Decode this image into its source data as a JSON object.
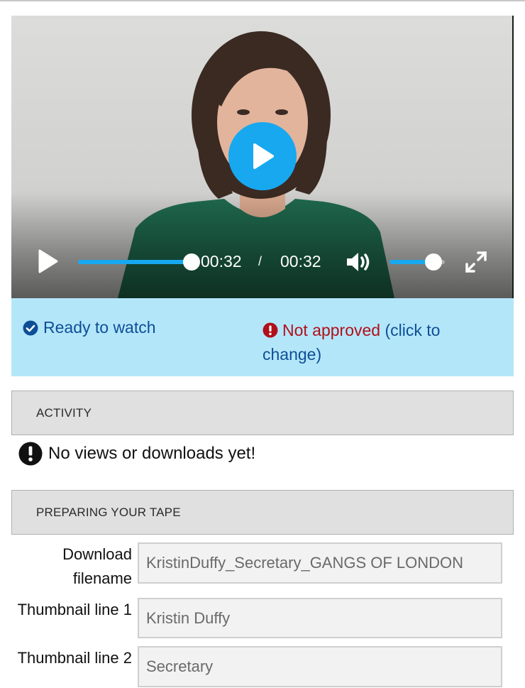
{
  "player": {
    "current_time": "00:32",
    "separator": "/",
    "duration": "00:32",
    "progress": 1.0,
    "volume": 0.8,
    "accent_color": "#17a8f0"
  },
  "status": {
    "ready_label": "Ready to watch",
    "approval_label": "Not approved",
    "approval_action": "(click to change)",
    "ready_color": "#0d4f96",
    "warning_color": "#b0101a",
    "background": "#b4e6fa"
  },
  "activity": {
    "header": "ACTIVITY",
    "empty_message": "No views or downloads yet!"
  },
  "preparing": {
    "header": "PREPARING YOUR TAPE",
    "fields": [
      {
        "label": "Download filename",
        "value": "KristinDuffy_Secretary_GANGS OF LONDON"
      },
      {
        "label": "Thumbnail line 1",
        "value": "Kristin Duffy"
      },
      {
        "label": "Thumbnail line 2",
        "value": "Secretary"
      }
    ]
  },
  "icons": {
    "ready": "check-circle-icon",
    "approval": "exclamation-circle-icon",
    "activity": "exclamation-circle-icon",
    "play": "play-icon",
    "volume": "volume-icon",
    "fullscreen": "fullscreen-icon"
  }
}
